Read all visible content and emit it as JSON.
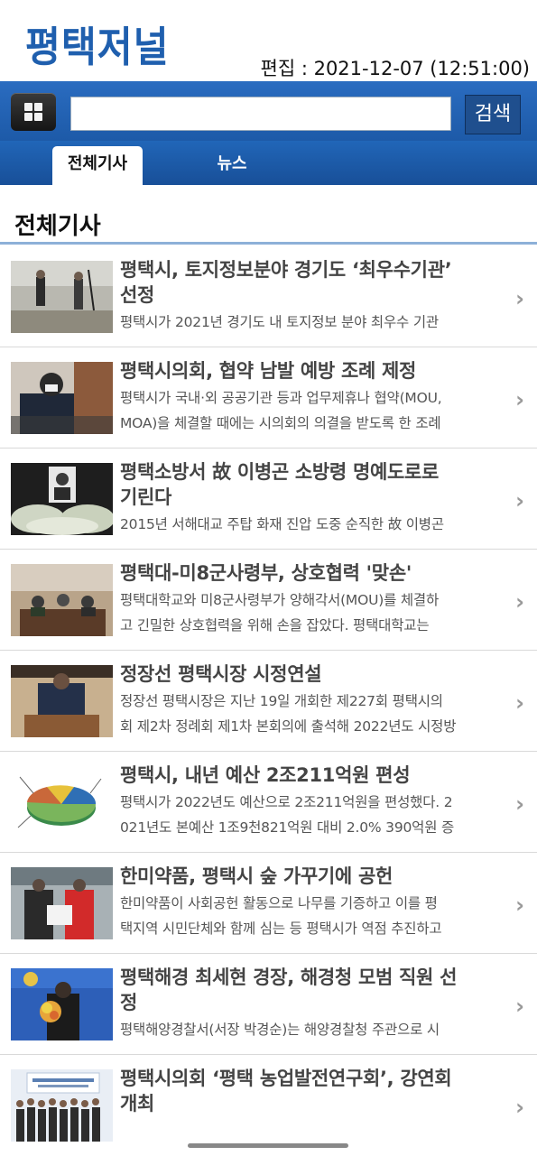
{
  "header": {
    "logo": "평택저널",
    "edit_time": "편집 : 2021-12-07 (12:51:00)"
  },
  "search": {
    "placeholder": "",
    "button_label": "검색"
  },
  "tabs": [
    {
      "label": "전체기사",
      "active": true
    },
    {
      "label": "뉴스",
      "active": false
    }
  ],
  "section_title": "전체기사",
  "articles": [
    {
      "headline_lines": [
        "평택시, 토지정보분야 경기도 ‘최우수기관’",
        "선정"
      ],
      "summary_lines": [
        "평택시가 2021년 경기도 내 토지정보 분야 최우수 기관"
      ],
      "thumb": "survey-workers-photo"
    },
    {
      "headline_lines": [
        "평택시의회, 협약 남발 예방 조례 제정"
      ],
      "summary_lines": [
        "평택시가 국내·외 공공기관 등과 업무제휴나 협약(MOU,",
        "MOA)을 체결할 때에는 시의회의 의결을 받도록 한 조례"
      ],
      "thumb": "council-member-photo"
    },
    {
      "headline_lines": [
        "평택소방서 故 이병곤 소방령 명예도로로",
        "기린다"
      ],
      "summary_lines": [
        "2015년 서해대교 주탑 화재 진압 도중 순직한 故 이병곤"
      ],
      "thumb": "memorial-portrait-photo"
    },
    {
      "headline_lines": [
        "평택대-미8군사령부, 상호협력 '맞손'"
      ],
      "summary_lines": [
        "평택대학교와 미8군사령부가 양해각서(MOU)를 체결하",
        "고 긴밀한 상호협력을 위해 손을 잡았다.   평택대학교는"
      ],
      "thumb": "mou-signing-photo"
    },
    {
      "headline_lines": [
        "정장선 평택시장 시정연설"
      ],
      "summary_lines": [
        "정장선 평택시장은 지난 19일 개회한 제227회 평택시의",
        "회 제2차 정례회 제1차 본회의에 출석해 2022년도 시정방"
      ],
      "thumb": "mayor-speech-photo"
    },
    {
      "headline_lines": [
        "평택시, 내년 예산 2조211억원 편성"
      ],
      "summary_lines": [
        "평택시가 2022년도 예산으로 2조211억원을 편성했다. 2",
        "021년도 본예산 1조9천821억원 대비 2.0% 390억원 증"
      ],
      "thumb": "budget-pie-chart"
    },
    {
      "headline_lines": [
        "한미약품, 평택시 숲 가꾸기에 공헌"
      ],
      "summary_lines": [
        "한미약품이 사회공헌 활동으로 나무를 기증하고 이를 평",
        "택지역 시민단체와 함께 심는 등 평택시가 역점 추진하고"
      ],
      "thumb": "donation-photo"
    },
    {
      "headline_lines": [
        "평택해경 최세현 경장, 해경청 모범 직원 선",
        "정"
      ],
      "summary_lines": [
        "평택해양경찰서(서장 박경순)는 해양경찰청 주관으로 시"
      ],
      "thumb": "coast-guard-photo"
    },
    {
      "headline_lines": [
        "평택시의회 ‘평택 농업발전연구회’, 강연회",
        "개최"
      ],
      "summary_lines": [],
      "thumb": "lecture-group-photo"
    }
  ],
  "chevron": "›"
}
